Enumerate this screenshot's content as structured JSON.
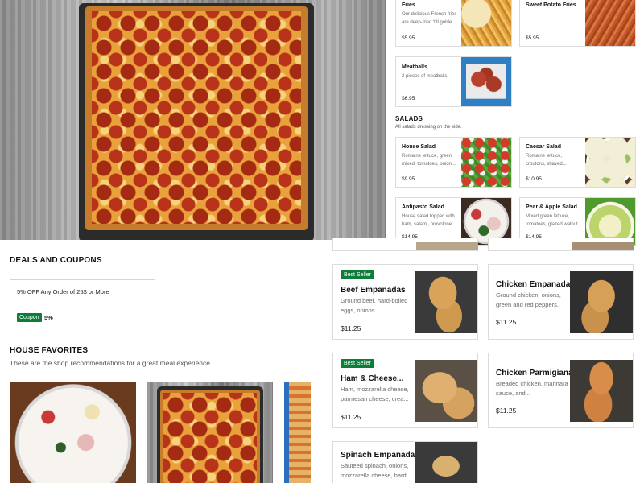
{
  "menu": {
    "sides": [
      {
        "name": "Fries",
        "description": "Our delicious French fries are deep-fried 'till golde...",
        "price": "$5.95",
        "image": "fries-photo"
      },
      {
        "name": "Sweet Potato Fries",
        "description": "",
        "price": "$5.95",
        "image": "sweet-potato-fries-photo"
      },
      {
        "name": "Meatballs",
        "description": "2 pieces of meatballs.",
        "price": "$6.95",
        "image": "meatballs-photo"
      }
    ],
    "salads": {
      "title": "SALADS",
      "subtitle": "All salads dressing on the side.",
      "items": [
        {
          "name": "House Salad",
          "description": "Romaine lettuce, green mixed, tomatoes, onion...",
          "price": "$9.95",
          "image": "house-salad-photo"
        },
        {
          "name": "Caesar Salad",
          "description": "Romaine lettuce, croutons, shaved...",
          "price": "$10.95",
          "image": "caesar-salad-photo"
        },
        {
          "name": "Antipasto Salad",
          "description": "House salad topped with ham, salami, provolone,...",
          "price": "$14.95",
          "image": "antipasto-salad-photo"
        },
        {
          "name": "Pear & Apple Salad",
          "description": "Mixed green lettuce, tomatoes, glazed walnut...",
          "price": "$14.95",
          "image": "pear-apple-salad-photo"
        }
      ]
    },
    "empanadas": [
      {
        "badge": "Best Seller",
        "name": "Beef Empanadas",
        "description": "Ground beef, hard-boiled eggs, onions.",
        "price": "$11.25",
        "image": "beef-empanadas-photo"
      },
      {
        "badge": "",
        "name": "Chicken Empanadas",
        "description": "Ground chicken, onions, green and red peppers.",
        "price": "$11.25",
        "image": "chicken-empanadas-photo"
      },
      {
        "badge": "Best Seller",
        "name": "Ham & Cheese...",
        "description": "Ham, mozzarella cheese, parmesan cheese, crea...",
        "price": "$11.25",
        "image": "ham-cheese-empanadas-photo"
      },
      {
        "badge": "",
        "name": "Chicken Parmigiana...",
        "description": "Breaded chicken, marinara sauce, and...",
        "price": "$11.25",
        "image": "chicken-parmigiana-photo"
      },
      {
        "badge": "",
        "name": "Spinach Empanadas",
        "description": "Sauteed spinach, onions, mozzarella cheese, hard...",
        "price": "",
        "image": "spinach-empanadas-photo"
      }
    ]
  },
  "deals": {
    "title": "DEALS AND COUPONS",
    "coupon": {
      "title": "5% OFF Any Order of 25$ or More",
      "badge": "Coupon",
      "value": "5%"
    }
  },
  "favorites": {
    "title": "HOUSE FAVORITES",
    "subtitle": "These are the shop recommendations for a great meal experience."
  },
  "colors": {
    "accent_green": "#0e7d3a",
    "border": "#dcdcdc",
    "text_muted": "#6b6b6b"
  }
}
